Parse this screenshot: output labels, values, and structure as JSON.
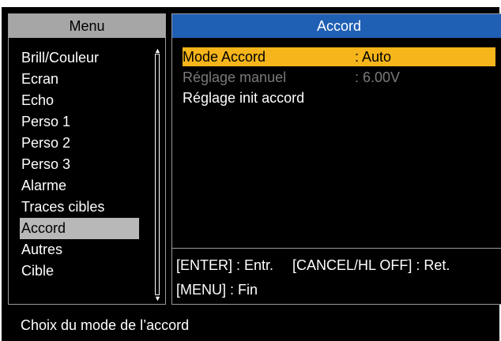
{
  "menu": {
    "title": "Menu",
    "items": [
      {
        "label": "Brill/Couleur"
      },
      {
        "label": "Ecran"
      },
      {
        "label": "Echo"
      },
      {
        "label": "Perso 1"
      },
      {
        "label": "Perso 2"
      },
      {
        "label": "Perso 3"
      },
      {
        "label": "Alarme"
      },
      {
        "label": "Traces cibles"
      },
      {
        "label": "Accord"
      },
      {
        "label": "Autres"
      },
      {
        "label": "Cible"
      }
    ],
    "selected": "Accord"
  },
  "panel": {
    "title": "Accord",
    "settings": [
      {
        "label": "Mode Accord",
        "value": ": Auto"
      },
      {
        "label": "Réglage manuel",
        "value": ": 6.00V"
      },
      {
        "label": "Réglage init accord",
        "value": ""
      }
    ],
    "keys": {
      "enter": "[ENTER] : Entr.",
      "cancel": "[CANCEL/HL OFF] : Ret.",
      "menu": "[MENU] : Fin"
    }
  },
  "status": {
    "text": "Choix du mode de l’accord"
  },
  "colors": {
    "header_menu_bg": "#a6a6a6",
    "header_accord_bg": "#1f5fb4",
    "highlight": "#f5b51b",
    "selected_item": "#b8b8b8",
    "disabled_text": "#7a7a7a",
    "background": "#000000"
  }
}
